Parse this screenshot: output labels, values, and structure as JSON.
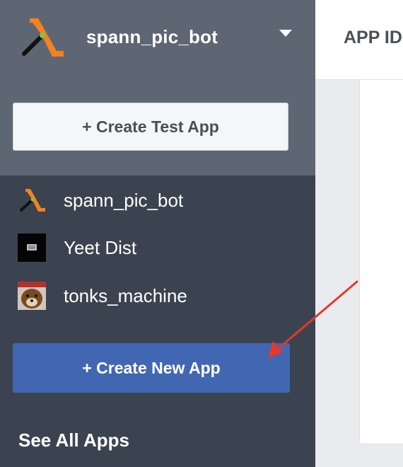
{
  "app_switcher": {
    "current_app_name": "spann_pic_bot",
    "dropdown_icon": "caret-down-icon",
    "logo_icon": "lambda-logo-icon"
  },
  "buttons": {
    "create_test_app": "+ Create Test App",
    "create_new_app": "+ Create New App"
  },
  "apps": [
    {
      "name": "spann_pic_bot",
      "icon": "lambda-logo-icon"
    },
    {
      "name": "Yeet Dist",
      "icon": "dark-app-icon"
    },
    {
      "name": "tonks_machine",
      "icon": "dog-photo-icon"
    }
  ],
  "links": {
    "see_all_apps": "See All Apps"
  },
  "header": {
    "app_id_label": "APP ID"
  },
  "colors": {
    "sidebar_dark": "#3b4350",
    "sidebar_light": "#5f6673",
    "primary_button": "#4267b2",
    "logo_orange": "#f5821f",
    "annotation_arrow": "#e8372b"
  }
}
